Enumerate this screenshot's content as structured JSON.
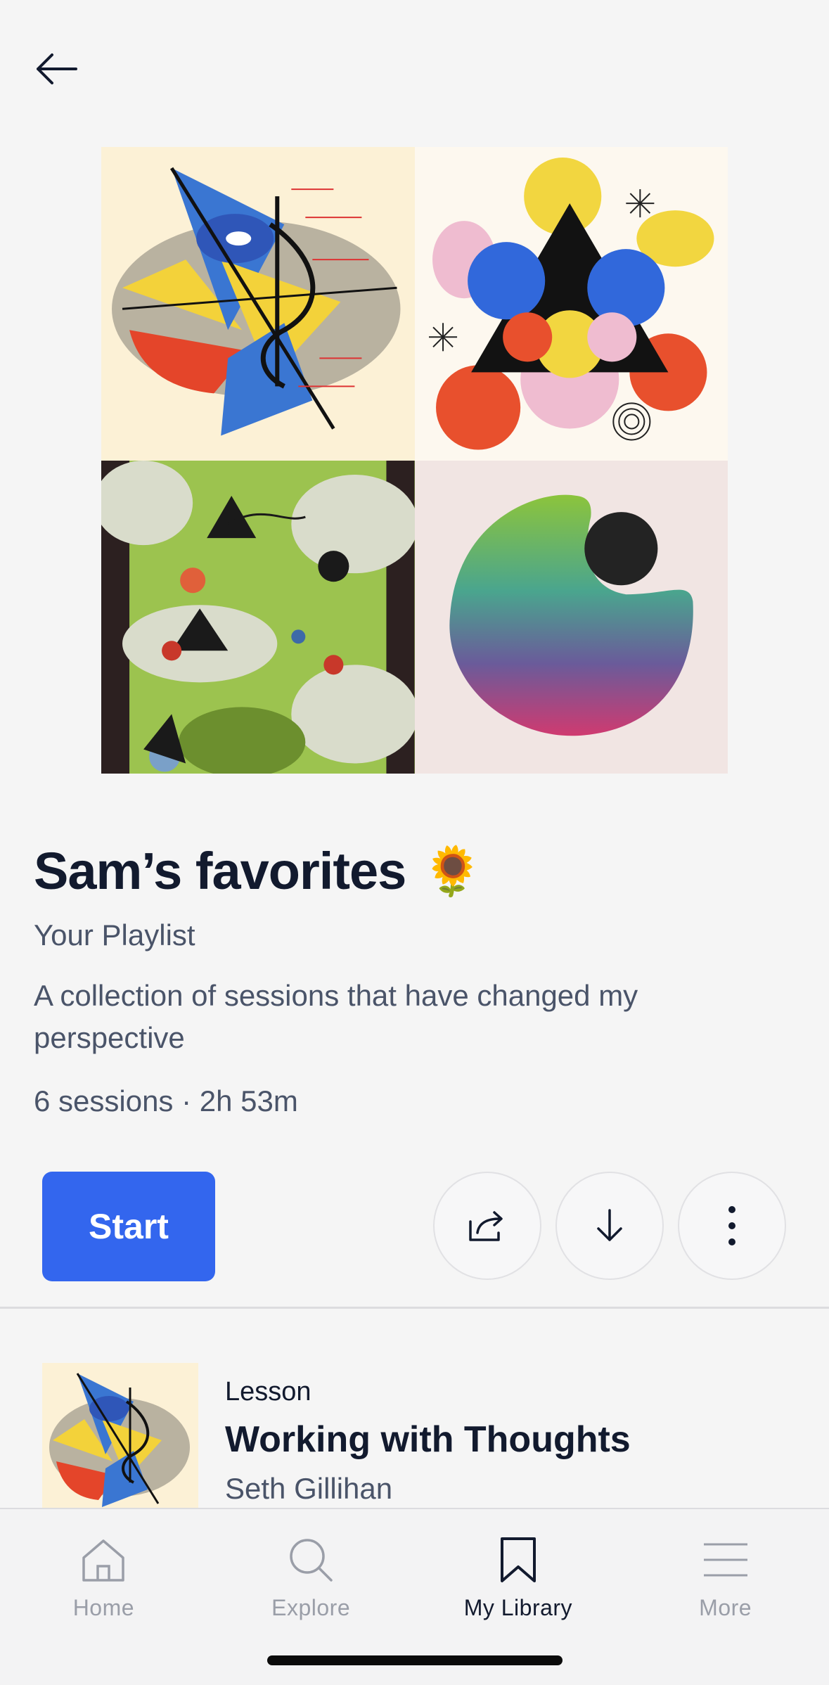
{
  "nav": {
    "back_icon": "arrow-left-icon"
  },
  "playlist": {
    "title": "Sam’s favorites",
    "emoji": "🌻",
    "subtitle": "Your Playlist",
    "description": "A collection of sessions that have changed my perspective",
    "meta": "6 sessions · 2h 53m"
  },
  "actions": {
    "start_label": "Start",
    "share_icon": "share-icon",
    "download_icon": "download-icon",
    "more_icon": "more-vertical-icon"
  },
  "sessions": [
    {
      "type": "Lesson",
      "title": "Working with Thoughts",
      "author": "Seth Gillihan"
    }
  ],
  "tabbar": {
    "items": [
      {
        "label": "Home",
        "icon": "home-icon",
        "active": false
      },
      {
        "label": "Explore",
        "icon": "search-icon",
        "active": false
      },
      {
        "label": "My Library",
        "icon": "bookmark-icon",
        "active": true
      },
      {
        "label": "More",
        "icon": "menu-icon",
        "active": false
      }
    ]
  },
  "colors": {
    "accent": "#3366ee",
    "text_primary": "#121a2e",
    "text_secondary": "#4a5469",
    "tab_inactive": "#9a9ea8"
  }
}
